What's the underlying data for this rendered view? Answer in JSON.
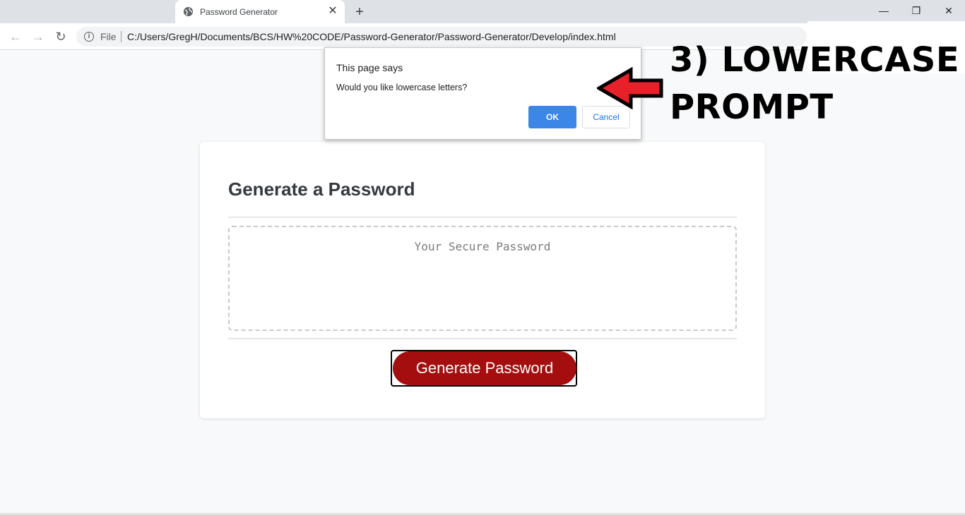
{
  "browser": {
    "tab": {
      "title": "Password Generator",
      "close_glyph": "✕",
      "favicon": "globe-icon"
    },
    "new_tab_glyph": "+",
    "window_controls": {
      "minimize": "—",
      "maximize": "❐",
      "close": "✕"
    },
    "nav": {
      "back": "←",
      "forward": "→",
      "reload": "↻"
    },
    "omnibox": {
      "info_glyph": "i",
      "scheme_label": "File",
      "url": "C:/Users/GregH/Documents/BCS/HW%20CODE/Password-Generator/Password-Generator/Develop/index.html"
    }
  },
  "annotation": {
    "line1": "3) LOWERCASE",
    "line2": "PROMPT",
    "arrow_color": "#e8202a"
  },
  "dialog": {
    "title": "This page says",
    "message": "Would you like lowercase letters?",
    "ok_label": "OK",
    "cancel_label": "Cancel"
  },
  "card": {
    "title": "Generate a Password",
    "password_placeholder": "Your Secure Password",
    "generate_label": "Generate Password",
    "button_color": "#a50e0e"
  }
}
